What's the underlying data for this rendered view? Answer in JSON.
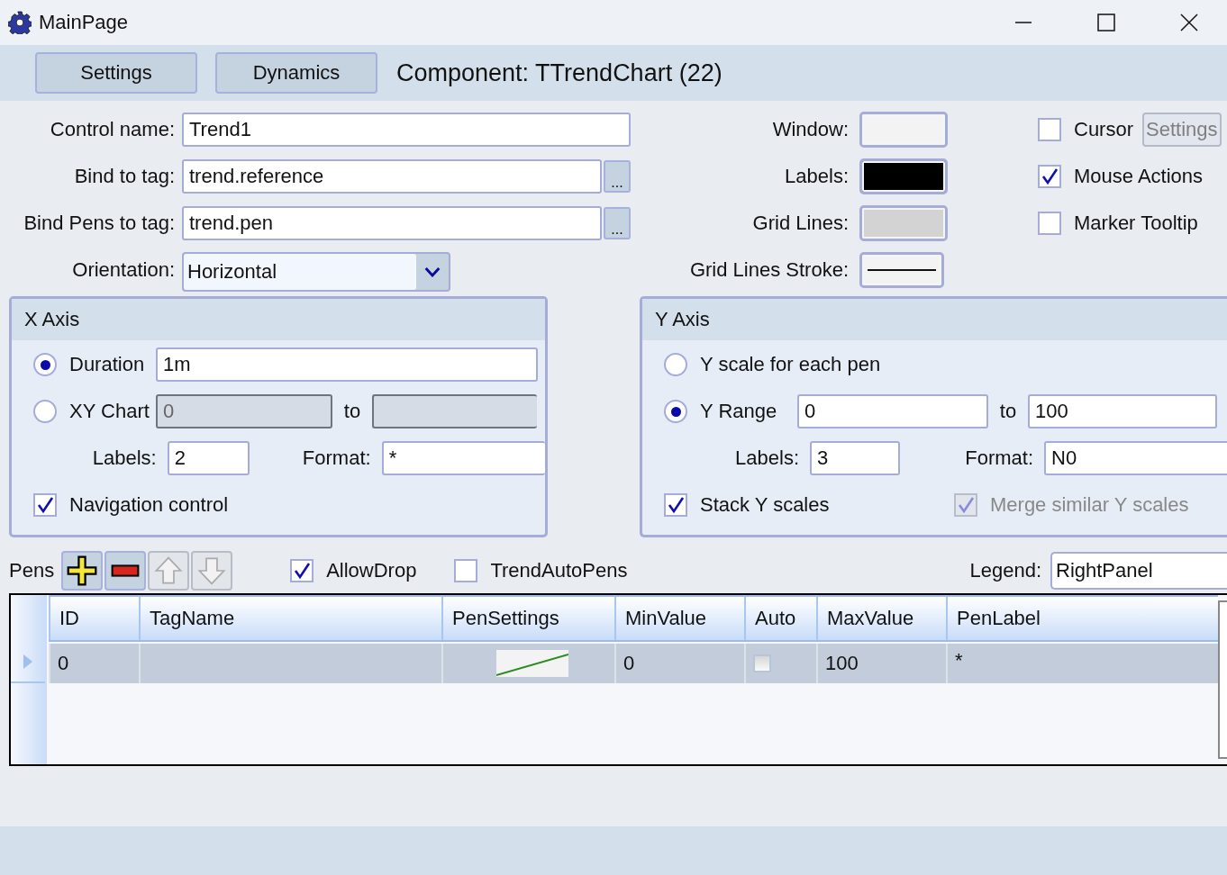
{
  "window": {
    "title": "MainPage"
  },
  "toolbar": {
    "buttons": [
      {
        "label": "Settings"
      },
      {
        "label": "Dynamics"
      }
    ],
    "heading": "Component: TTrendChart (22)"
  },
  "general_fields": [
    {
      "label": "Control name:",
      "value": "Trend1",
      "kind": "text"
    },
    {
      "label": "Bind to tag:",
      "value": "trend.reference",
      "kind": "browse",
      "button": "..."
    },
    {
      "label": "Bind Pens to tag:",
      "value": "trend.pen",
      "kind": "browse",
      "button": "..."
    },
    {
      "label": "Orientation:",
      "value": "Horizontal",
      "kind": "dropdown"
    }
  ],
  "colors": [
    {
      "label": "Window:",
      "color": "#f3f3f3",
      "kind": "swatch"
    },
    {
      "label": "Labels:",
      "color": "#000000",
      "kind": "swatch"
    },
    {
      "label": "Grid Lines:",
      "color": "#d3d3d3",
      "kind": "swatch"
    },
    {
      "label": "Grid Lines Stroke:",
      "kind": "stroke"
    }
  ],
  "options": [
    {
      "label": "Cursor",
      "checked": false,
      "button": "Settings"
    },
    {
      "label": "Mouse Actions",
      "checked": true
    },
    {
      "label": "Marker Tooltip",
      "checked": false
    }
  ],
  "x_axis": {
    "title": "X Axis",
    "duration": {
      "label": "Duration",
      "selected": true,
      "value": "1m"
    },
    "xy_chart": {
      "label": "XY Chart",
      "selected": false,
      "disabled": true,
      "from": "0",
      "to_label": "to"
    },
    "labels": {
      "label": "Labels:",
      "value": "2"
    },
    "format": {
      "label": "Format:",
      "value": "*"
    },
    "navigation": {
      "label": "Navigation control",
      "checked": true
    }
  },
  "y_axis": {
    "title": "Y Axis",
    "each_pen": {
      "label": "Y scale for each pen",
      "selected": false
    },
    "range": {
      "label": "Y Range",
      "selected": true,
      "from": "0",
      "to_label": "to",
      "to": "100"
    },
    "labels": {
      "label": "Labels:",
      "value": "3"
    },
    "format": {
      "label": "Format:",
      "value": "N0"
    },
    "stack": {
      "label": "Stack Y scales",
      "checked": true,
      "disabled": false
    },
    "merge": {
      "label": "Merge similar Y scales",
      "checked": true,
      "disabled": true
    }
  },
  "pens": {
    "label": "Pens",
    "allow_drop": {
      "label": "AllowDrop",
      "checked": true
    },
    "auto_pens": {
      "label": "TrendAutoPens",
      "checked": false
    },
    "legend": {
      "label": "Legend:",
      "value": "RightPanel"
    },
    "table": {
      "columns": [
        "ID",
        "TagName",
        "PenSettings",
        "MinValue",
        "Auto",
        "MaxValue",
        "PenLabel"
      ],
      "rows": [
        {
          "selected": true,
          "id": "0",
          "color": "#2e8b22",
          "min": "0",
          "auto": false,
          "max": "100",
          "pen_label": "*"
        }
      ]
    }
  }
}
